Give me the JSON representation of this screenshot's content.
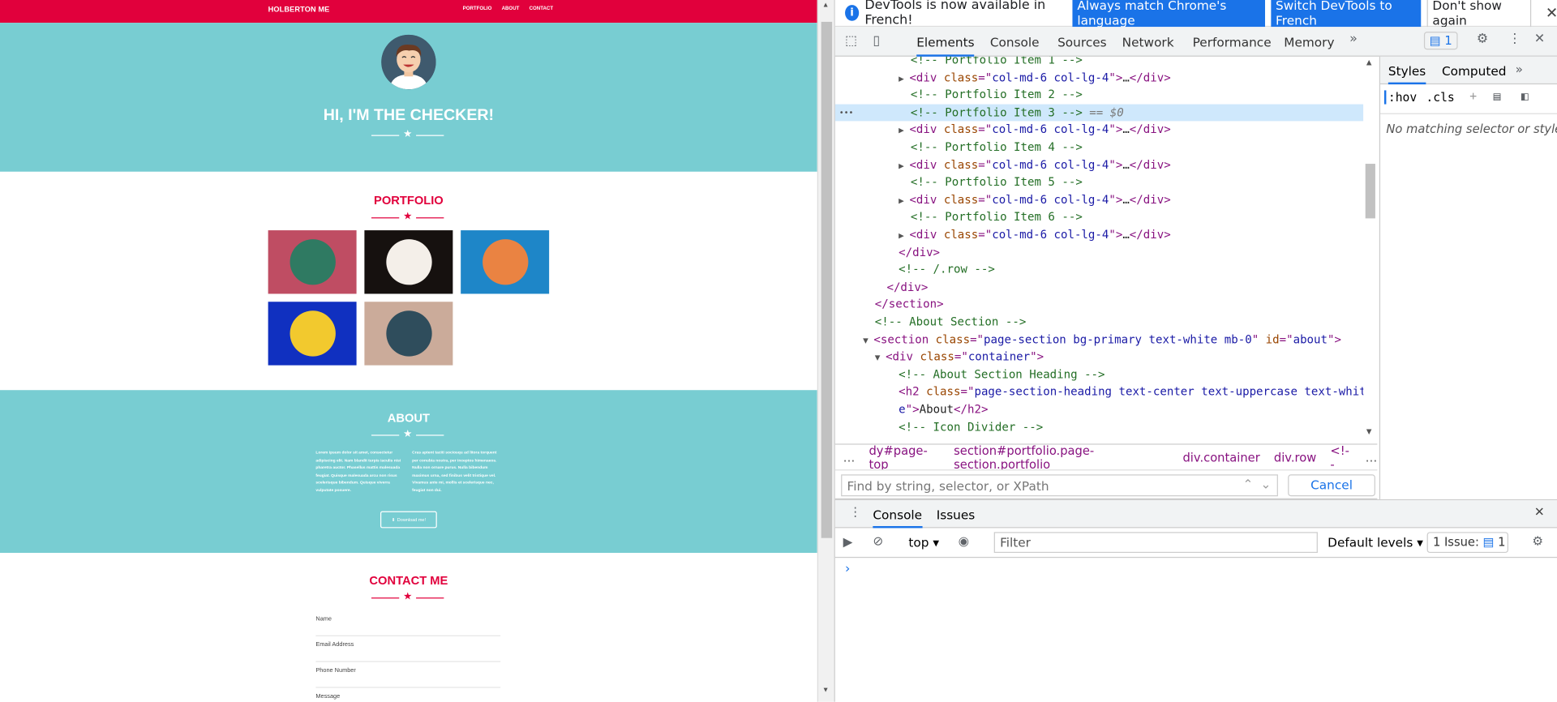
{
  "page": {
    "brand": "HOLBERTON ME",
    "nav": [
      "PORTFOLIO",
      "ABOUT",
      "CONTACT"
    ],
    "masthead_title": "HI, I'M THE CHECKER!",
    "portfolio_title": "PORTFOLIO",
    "portfolio_items": [
      {
        "name": "cabin",
        "bg": "#bf4d63",
        "circle": "#2f7a62"
      },
      {
        "name": "circus-tent",
        "bg": "#16110f",
        "circle": "#f4efe9"
      },
      {
        "name": "game-controller",
        "bg": "#1e86c8",
        "circle": "#ea8342"
      },
      {
        "name": "safe",
        "bg": "#1030c0",
        "circle": "#f2c92e"
      },
      {
        "name": "submarine",
        "bg": "#cbab9a",
        "circle": "#2f4d5c"
      }
    ],
    "about_title": "ABOUT",
    "about_left": "Lorem ipsum dolor sit amet, consectetur adipiscing elit. Nam blandit turpis iaculis nisi pharetra auctor. Phasellus mattis malesuada feugiat. Quisque malesuada arcu non risus scelerisque bibendum. Quisque viverra vulputate posuere.",
    "about_right": "Cras aptent taciti sociosqu ad litora torquent per conubia nostra, per inceptos himenaeos. Nulla non ornare purus. Nulla bibendum maximus urna, sed finibus velit tristique vel. Vivamus ante mi, mollis et scelerisque nec, feugiat non dui.",
    "download_label": "Download me!",
    "contact_title": "CONTACT ME",
    "fields": [
      "Name",
      "Email Address",
      "Phone Number",
      "Message"
    ]
  },
  "devtools": {
    "infobar": {
      "message": "DevTools is now available in French!",
      "btn_match": "Always match Chrome's language",
      "btn_switch": "Switch DevTools to French",
      "btn_dismiss": "Don't show again"
    },
    "tabs": [
      "Elements",
      "Console",
      "Sources",
      "Network",
      "Performance",
      "Memory"
    ],
    "issues_count": "1",
    "elements_lines": [
      {
        "indent": 76,
        "tri": "",
        "parts": [
          [
            "c-com",
            "<!-- Portfolio Item 1 -->"
          ]
        ]
      },
      {
        "indent": 76,
        "tri": "▶",
        "parts": [
          [
            "c-tag",
            "<div "
          ],
          [
            "c-attr",
            "class"
          ],
          [
            "c-tag",
            "=\""
          ],
          [
            "c-val",
            "col-md-6 col-lg-4"
          ],
          [
            "c-tag",
            "\">"
          ],
          [
            "c-txt",
            "…"
          ],
          [
            "c-tag",
            "</div>"
          ]
        ]
      },
      {
        "indent": 76,
        "tri": "",
        "parts": [
          [
            "c-com",
            "<!-- Portfolio Item 2 -->"
          ]
        ]
      },
      {
        "indent": 76,
        "tri": "",
        "sel": true,
        "parts": [
          [
            "c-com",
            "<!-- Portfolio Item 3 -->"
          ],
          [
            "c-ghost",
            " == $0"
          ]
        ]
      },
      {
        "indent": 76,
        "tri": "▶",
        "parts": [
          [
            "c-tag",
            "<div "
          ],
          [
            "c-attr",
            "class"
          ],
          [
            "c-tag",
            "=\""
          ],
          [
            "c-val",
            "col-md-6 col-lg-4"
          ],
          [
            "c-tag",
            "\">"
          ],
          [
            "c-txt",
            "…"
          ],
          [
            "c-tag",
            "</div>"
          ]
        ]
      },
      {
        "indent": 76,
        "tri": "",
        "parts": [
          [
            "c-com",
            "<!-- Portfolio Item 4 -->"
          ]
        ]
      },
      {
        "indent": 76,
        "tri": "▶",
        "parts": [
          [
            "c-tag",
            "<div "
          ],
          [
            "c-attr",
            "class"
          ],
          [
            "c-tag",
            "=\""
          ],
          [
            "c-val",
            "col-md-6 col-lg-4"
          ],
          [
            "c-tag",
            "\">"
          ],
          [
            "c-txt",
            "…"
          ],
          [
            "c-tag",
            "</div>"
          ]
        ]
      },
      {
        "indent": 76,
        "tri": "",
        "parts": [
          [
            "c-com",
            "<!-- Portfolio Item 5 -->"
          ]
        ]
      },
      {
        "indent": 76,
        "tri": "▶",
        "parts": [
          [
            "c-tag",
            "<div "
          ],
          [
            "c-attr",
            "class"
          ],
          [
            "c-tag",
            "=\""
          ],
          [
            "c-val",
            "col-md-6 col-lg-4"
          ],
          [
            "c-tag",
            "\">"
          ],
          [
            "c-txt",
            "…"
          ],
          [
            "c-tag",
            "</div>"
          ]
        ]
      },
      {
        "indent": 76,
        "tri": "",
        "parts": [
          [
            "c-com",
            "<!-- Portfolio Item 6 -->"
          ]
        ]
      },
      {
        "indent": 76,
        "tri": "▶",
        "parts": [
          [
            "c-tag",
            "<div "
          ],
          [
            "c-attr",
            "class"
          ],
          [
            "c-tag",
            "=\""
          ],
          [
            "c-val",
            "col-md-6 col-lg-4"
          ],
          [
            "c-tag",
            "\">"
          ],
          [
            "c-txt",
            "…"
          ],
          [
            "c-tag",
            "</div>"
          ]
        ]
      },
      {
        "indent": 64,
        "tri": "",
        "parts": [
          [
            "c-tag",
            "</div>"
          ]
        ]
      },
      {
        "indent": 64,
        "tri": "",
        "parts": [
          [
            "c-com",
            "<!-- /.row -->"
          ]
        ]
      },
      {
        "indent": 52,
        "tri": "",
        "parts": [
          [
            "c-tag",
            "</div>"
          ]
        ]
      },
      {
        "indent": 40,
        "tri": "",
        "parts": [
          [
            "c-tag",
            "</section>"
          ]
        ]
      },
      {
        "indent": 40,
        "tri": "",
        "parts": [
          [
            "c-com",
            "<!-- About Section -->"
          ]
        ]
      },
      {
        "indent": 40,
        "tri": "▼",
        "parts": [
          [
            "c-tag",
            "<section "
          ],
          [
            "c-attr",
            "class"
          ],
          [
            "c-tag",
            "=\""
          ],
          [
            "c-val",
            "page-section bg-primary text-white mb-0"
          ],
          [
            "c-tag",
            "\" "
          ],
          [
            "c-attr",
            "id"
          ],
          [
            "c-tag",
            "=\""
          ],
          [
            "c-val",
            "about"
          ],
          [
            "c-tag",
            "\">"
          ]
        ]
      },
      {
        "indent": 52,
        "tri": "▼",
        "parts": [
          [
            "c-tag",
            "<div "
          ],
          [
            "c-attr",
            "class"
          ],
          [
            "c-tag",
            "=\""
          ],
          [
            "c-val",
            "container"
          ],
          [
            "c-tag",
            "\">"
          ]
        ]
      },
      {
        "indent": 64,
        "tri": "",
        "parts": [
          [
            "c-com",
            "<!-- About Section Heading -->"
          ]
        ]
      },
      {
        "indent": 64,
        "tri": "",
        "parts": [
          [
            "c-tag",
            "<h2 "
          ],
          [
            "c-attr",
            "class"
          ],
          [
            "c-tag",
            "=\""
          ],
          [
            "c-val",
            "page-section-heading text-center text-uppercase text-whit"
          ]
        ]
      },
      {
        "indent": 64,
        "tri": "",
        "parts": [
          [
            "c-val",
            "e"
          ],
          [
            "c-tag",
            "\">"
          ],
          [
            "c-txt",
            "About"
          ],
          [
            "c-tag",
            "</h2>"
          ]
        ]
      },
      {
        "indent": 64,
        "tri": "",
        "parts": [
          [
            "c-com",
            "<!-- Icon Divider -->"
          ]
        ]
      }
    ],
    "breadcrumbs": [
      "…",
      "dy#page-top",
      "section#portfolio.page-section.portfolio",
      "div.container",
      "div.row",
      "<!--",
      "…"
    ],
    "find_placeholder": "Find by string, selector, or XPath",
    "cancel_label": "Cancel",
    "styles_tabs": [
      "Styles",
      "Computed"
    ],
    "styles_toolbar": [
      ":hov",
      ".cls",
      "+"
    ],
    "no_match": "No matching selector or style",
    "drawer_tabs": [
      "Console",
      "Issues"
    ],
    "context": "top",
    "filter_placeholder": "Filter",
    "levels": "Default levels",
    "issue_label": "1 Issue:",
    "issue_count": "1"
  }
}
